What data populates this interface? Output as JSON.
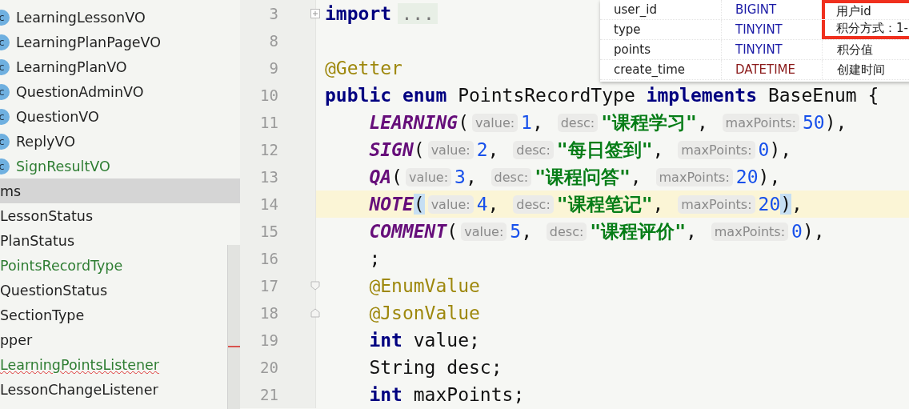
{
  "project_tree": {
    "items": [
      {
        "label": "LearningLessonVO",
        "badge": "c",
        "color": "#1f1f1f",
        "selected": false,
        "error": false
      },
      {
        "label": "LearningPlanPageVO",
        "badge": "c",
        "color": "#1f1f1f",
        "selected": false,
        "error": false
      },
      {
        "label": "LearningPlanVO",
        "badge": "c",
        "color": "#1f1f1f",
        "selected": false,
        "error": false
      },
      {
        "label": "QuestionAdminVO",
        "badge": "c",
        "color": "#1f1f1f",
        "selected": false,
        "error": false
      },
      {
        "label": "QuestionVO",
        "badge": "c",
        "color": "#1f1f1f",
        "selected": false,
        "error": false
      },
      {
        "label": "ReplyVO",
        "badge": "c",
        "color": "#1f1f1f",
        "selected": false,
        "error": false
      },
      {
        "label": "SignResultVO",
        "badge": "c",
        "color": "#2e7d32",
        "selected": false,
        "error": false
      },
      {
        "label": "ms",
        "color": "#1f1f1f",
        "selected": true,
        "error": false
      },
      {
        "label": "LessonStatus",
        "color": "#1f1f1f",
        "selected": false,
        "error": false
      },
      {
        "label": "PlanStatus",
        "color": "#1f1f1f",
        "selected": false,
        "error": false
      },
      {
        "label": "PointsRecordType",
        "color": "#2e7d32",
        "selected": false,
        "error": false
      },
      {
        "label": "QuestionStatus",
        "color": "#1f1f1f",
        "selected": false,
        "error": false
      },
      {
        "label": "SectionType",
        "color": "#1f1f1f",
        "selected": false,
        "error": false
      },
      {
        "label": "pper",
        "color": "#1f1f1f",
        "selected": false,
        "error": false
      },
      {
        "label": "LearningPointsListener",
        "color": "#2e7d32",
        "selected": false,
        "error": true
      },
      {
        "label": "LessonChangeListener",
        "color": "#1f1f1f",
        "selected": false,
        "error": false
      }
    ]
  },
  "editor": {
    "lines": [
      {
        "number": "3",
        "current": false,
        "indented": false,
        "fold": {
          "kind": "plus"
        },
        "tokens": [
          {
            "kind": "keyword",
            "text": "import"
          },
          {
            "kind": "folded",
            "text": "..."
          }
        ]
      },
      {
        "number": "8",
        "current": false
      },
      {
        "number": "9",
        "current": false,
        "indented": false,
        "tokens": [
          {
            "kind": "annotation",
            "text": "@Getter"
          }
        ]
      },
      {
        "number": "10",
        "current": false,
        "indented": false,
        "tokens": [
          {
            "kind": "keyword",
            "text": "public enum"
          },
          {
            "kind": "plain",
            "text": " PointsRecordType "
          },
          {
            "kind": "keyword",
            "text": "implements"
          },
          {
            "kind": "plain",
            "text": " BaseEnum {"
          }
        ]
      },
      {
        "number": "11",
        "current": false,
        "indented": true,
        "tokens": [
          {
            "kind": "constant",
            "text": "LEARNING"
          },
          {
            "kind": "plain",
            "text": "("
          },
          {
            "kind": "hint",
            "text": "value:"
          },
          {
            "kind": "number",
            "text": "1"
          },
          {
            "kind": "plain",
            "text": ", "
          },
          {
            "kind": "hint",
            "text": "desc:"
          },
          {
            "kind": "string",
            "text": "\"课程学习\""
          },
          {
            "kind": "plain",
            "text": ", "
          },
          {
            "kind": "hint",
            "text": "maxPoints:"
          },
          {
            "kind": "number",
            "text": "50"
          },
          {
            "kind": "plain",
            "text": "),"
          }
        ]
      },
      {
        "number": "12",
        "current": false,
        "indented": true,
        "tokens": [
          {
            "kind": "constant",
            "text": "SIGN"
          },
          {
            "kind": "plain",
            "text": "("
          },
          {
            "kind": "hint",
            "text": "value:"
          },
          {
            "kind": "number",
            "text": "2"
          },
          {
            "kind": "plain",
            "text": ", "
          },
          {
            "kind": "hint",
            "text": "desc:"
          },
          {
            "kind": "string",
            "text": "\"每日签到\""
          },
          {
            "kind": "plain",
            "text": ", "
          },
          {
            "kind": "hint",
            "text": "maxPoints:"
          },
          {
            "kind": "number",
            "text": "0"
          },
          {
            "kind": "plain",
            "text": "),"
          }
        ]
      },
      {
        "number": "13",
        "current": false,
        "indented": true,
        "tokens": [
          {
            "kind": "constant",
            "text": "QA"
          },
          {
            "kind": "plain",
            "text": "("
          },
          {
            "kind": "hint",
            "text": "value:"
          },
          {
            "kind": "number",
            "text": "3"
          },
          {
            "kind": "plain",
            "text": ", "
          },
          {
            "kind": "hint",
            "text": "desc:"
          },
          {
            "kind": "string",
            "text": "\"课程问答\""
          },
          {
            "kind": "plain",
            "text": ", "
          },
          {
            "kind": "hint",
            "text": "maxPoints:"
          },
          {
            "kind": "number",
            "text": "20"
          },
          {
            "kind": "plain",
            "text": "),"
          }
        ]
      },
      {
        "number": "14",
        "current": true,
        "indented": true,
        "tokens": [
          {
            "kind": "constant",
            "text": "NOTE"
          },
          {
            "kind": "brace",
            "text": "("
          },
          {
            "kind": "hint",
            "text": "value:"
          },
          {
            "kind": "number",
            "text": "4"
          },
          {
            "kind": "plain",
            "text": ", "
          },
          {
            "kind": "hint",
            "text": "desc:"
          },
          {
            "kind": "string",
            "text": "\"课程笔记\""
          },
          {
            "kind": "plain",
            "text": ", "
          },
          {
            "kind": "hint",
            "text": "maxPoints:"
          },
          {
            "kind": "number",
            "text": "20"
          },
          {
            "kind": "brace",
            "text": ")"
          },
          {
            "kind": "plain",
            "text": ","
          }
        ]
      },
      {
        "number": "15",
        "current": false,
        "indented": true,
        "tokens": [
          {
            "kind": "constant",
            "text": "COMMENT"
          },
          {
            "kind": "plain",
            "text": "("
          },
          {
            "kind": "hint",
            "text": "value:"
          },
          {
            "kind": "number",
            "text": "5"
          },
          {
            "kind": "plain",
            "text": ", "
          },
          {
            "kind": "hint",
            "text": "desc:"
          },
          {
            "kind": "string",
            "text": "\"课程评价\""
          },
          {
            "kind": "plain",
            "text": ", "
          },
          {
            "kind": "hint",
            "text": "maxPoints:"
          },
          {
            "kind": "number",
            "text": "0"
          },
          {
            "kind": "plain",
            "text": "),"
          }
        ]
      },
      {
        "number": "16",
        "current": false,
        "indented": true,
        "tokens": [
          {
            "kind": "plain",
            "text": ";"
          }
        ]
      },
      {
        "number": "17",
        "current": false,
        "indented": true,
        "fold": {
          "kind": "start"
        },
        "tokens": [
          {
            "kind": "annotation",
            "text": "@EnumValue"
          }
        ]
      },
      {
        "number": "18",
        "current": false,
        "indented": true,
        "fold": {
          "kind": "end"
        },
        "tokens": [
          {
            "kind": "annotation",
            "text": "@JsonValue"
          }
        ]
      },
      {
        "number": "19",
        "current": false,
        "indented": true,
        "tokens": [
          {
            "kind": "keyword",
            "text": "int"
          },
          {
            "kind": "plain",
            "text": " value;"
          }
        ]
      },
      {
        "number": "20",
        "current": false,
        "indented": true,
        "tokens": [
          {
            "kind": "plain",
            "text": "String desc;"
          }
        ]
      },
      {
        "number": "21",
        "current": false,
        "indented": true,
        "tokens": [
          {
            "kind": "keyword",
            "text": "int"
          },
          {
            "kind": "plain",
            "text": " maxPoints;"
          }
        ]
      }
    ]
  },
  "db_table": {
    "rows": [
      {
        "name": "user_id",
        "type": "BIGINT",
        "color": "#1a1aa6",
        "comment": "用户id",
        "highlighted": true
      },
      {
        "name": "type",
        "type": "TINYINT",
        "color": "#1a1aa6",
        "comment": "积分方式：1-",
        "highlighted": true
      },
      {
        "name": "points",
        "type": "TINYINT",
        "color": "#1a1aa6",
        "comment": "积分值",
        "highlighted": false
      },
      {
        "name": "create_time",
        "type": "DATETIME",
        "color": "#8b1a1a",
        "comment": "创建时间",
        "highlighted": false
      }
    ]
  }
}
